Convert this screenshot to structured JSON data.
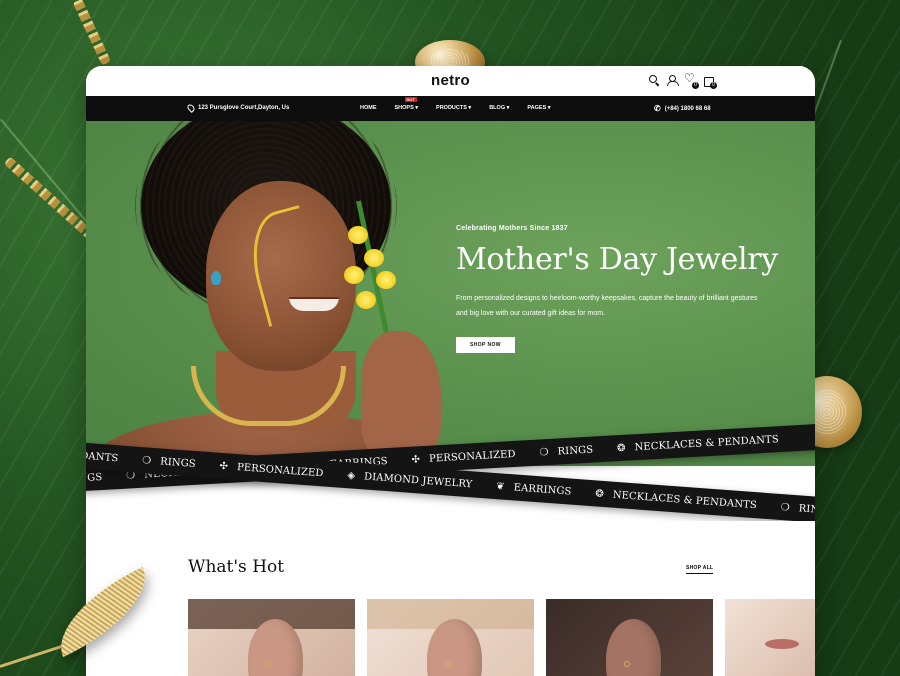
{
  "site": {
    "logo": "netro"
  },
  "topbar": {
    "icons": [
      "search-icon",
      "user-icon",
      "heart-icon",
      "bag-icon"
    ],
    "wishlist_count": "0",
    "cart_count": "0"
  },
  "navbar": {
    "address": "123 Pursglove Court,Dayton, Us",
    "menu": [
      {
        "label": "HOME"
      },
      {
        "label": "SHOPS ▾",
        "badge": "HOT"
      },
      {
        "label": "PRODUCTS ▾"
      },
      {
        "label": "BLOG ▾"
      },
      {
        "label": "PAGES ▾"
      }
    ],
    "phone": "(+84) 1800 68 68"
  },
  "hero": {
    "kicker": "Celebrating Mothers Since 1837",
    "title": "Mother's Day Jewelry",
    "description": "From personalized designs to heirloom-worthy keepsakes, capture the beauty of brilliant gestures and big love with our curated gift ideas for mom.",
    "button": "SHOP NOW",
    "slide_dots": 2,
    "active_slide": 1
  },
  "ribbons": {
    "top": [
      "& PENDANTS",
      "RINGS",
      "PERSONALIZED",
      "DIAMOND JEWELRY",
      "EARRINGS",
      "NECKLACES & PENDANTS",
      "RINGS"
    ],
    "bottom": [
      "RINGS",
      "NECKLACES & PENDANTS",
      "EARRINGS",
      "PERSONALIZED",
      "RINGS",
      "NECKLACES & PENDANTS"
    ]
  },
  "whats_hot": {
    "title": "What's Hot",
    "link": "SHOP ALL"
  },
  "colors": {
    "background": "#1f4a1d",
    "hero_green": "#5d9450",
    "nav_black": "#0d0d0d",
    "hot_badge": "#d41c1c",
    "gold": "#d9b54e"
  }
}
